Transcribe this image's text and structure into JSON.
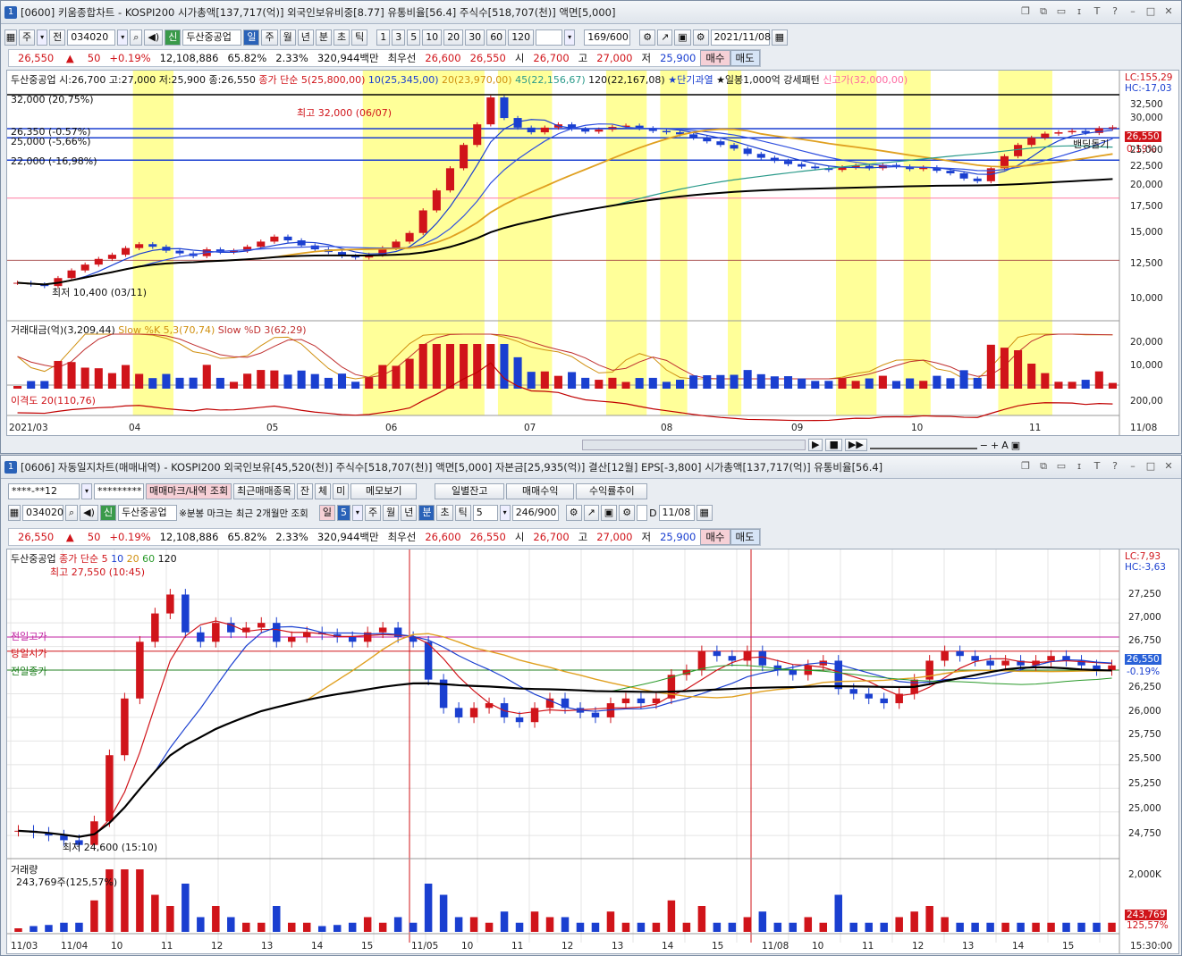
{
  "w1": {
    "title": "[0600] 키움종합차트 - KOSPI200 시가총액[137,717(억)] 외국인보유비중[8.77] 유통비율[56.4] 주식수[518,707(천)] 액면[5,000]",
    "win_num": "1",
    "toolbar": {
      "period_labels": [
        "주",
        "전"
      ],
      "code": "034020",
      "stock_badge": "신",
      "stock_name": "두산중공업",
      "periods": [
        "일",
        "주",
        "월",
        "년",
        "분",
        "초",
        "틱"
      ],
      "ticks": [
        "1",
        "3",
        "5",
        "10",
        "20",
        "30",
        "60",
        "120"
      ],
      "count": "169/600",
      "date": "2021/11/08"
    },
    "quote": {
      "price": "26,550",
      "arrow": "▲",
      "chg": "50",
      "pct": "+0.19%",
      "vol": "12,108,886",
      "p1": "65.82%",
      "p2": "2.33%",
      "amt": "320,944백만",
      "best": "최우선",
      "bid": "26,600",
      "ask": "26,550",
      "open_l": "시",
      "open": "26,700",
      "high_l": "고",
      "high": "27,000",
      "low_l": "저",
      "low": "25,900",
      "buy": "매수",
      "sell": "매도"
    },
    "legend": {
      "stock": "두산중공업 시:26,700 고:27,000 저:25,900 종:26,550",
      "ma_title": "종가 단순",
      "ma5": "5(25,800,00)",
      "ma10": "10(25,345,00)",
      "ma20": "20(23,970,00)",
      "ma45": "45(22,156,67)",
      "ma120": "120(22,167,08)",
      "star1": "★단기과열",
      "star2": "★일봉1,000억 강세패턴",
      "newhigh": "신고가(32,000,00)"
    },
    "right_tags": {
      "lc": "LC:155,29",
      "hc": "HC:-17,03",
      "price": "26,550",
      "pct": "0.19%"
    },
    "yaxis": [
      "32,500",
      "30,000",
      "27,500",
      "25,000",
      "22,500",
      "20,000",
      "17,500",
      "15,000",
      "12,500",
      "10,000"
    ],
    "hlines": {
      "l1": "32,000 (20,75%)",
      "l2": "26,350 (-0.57%)",
      "l3": "25,000 (-5,66%)",
      "l4": "22,000 (-16,98%)",
      "high": "최고 32,000 (06/07)",
      "low": "최저 10,400 (03/11)",
      "note": "밴딩돌기"
    },
    "sub": {
      "legend1": "거래대금(억)(3,209,44)",
      "legend2": "Slow %K 5,3(70,74)",
      "legend3": "Slow %D 3(62,29)",
      "y1": "20,000",
      "y2": "10,000"
    },
    "disp": {
      "legend": "이격도 20(110,76)",
      "y": "200,00"
    },
    "xaxis": [
      "2021/03",
      "04",
      "05",
      "06",
      "07",
      "08",
      "09",
      "10",
      "11",
      "11/08"
    ],
    "colors": {
      "ma5": "#1a3fd0",
      "ma20": "#e0a020",
      "ma45": "#2a9a8a",
      "ma120": "#000000",
      "up": "#d0141a",
      "dn": "#1a3fd0",
      "band": "#ffff99"
    },
    "chart_data": {
      "type": "candlestick",
      "title": "두산중공업",
      "ylim": [
        9000,
        33500
      ],
      "note": "daily candles 2021/03-2021/11/08",
      "closes": [
        10900,
        10800,
        10700,
        11200,
        11700,
        12100,
        12500,
        12800,
        13300,
        13600,
        13400,
        13100,
        12900,
        12700,
        13200,
        13000,
        13100,
        13400,
        13800,
        14200,
        13900,
        13500,
        13200,
        13000,
        12700,
        12600,
        12800,
        13300,
        13800,
        14500,
        16500,
        18500,
        21000,
        24000,
        27000,
        31500,
        28000,
        26500,
        25800,
        26500,
        27000,
        26300,
        25900,
        26200,
        26600,
        26800,
        26400,
        26000,
        25800,
        25500,
        25000,
        24500,
        24000,
        23500,
        22800,
        22300,
        21900,
        21500,
        21200,
        21000,
        20800,
        21100,
        21300,
        21000,
        21400,
        21200,
        20900,
        21100,
        20700,
        20400,
        19800,
        19500,
        21000,
        22500,
        24000,
        25000,
        25600,
        25800,
        26000,
        25700,
        26400,
        26550
      ]
    }
  },
  "w2": {
    "title": "[0606] 자동일지차트(매매내역) - KOSPI200 외국인보유[45,520(천)] 주식수[518,707(천)] 액면[5,000] 자본금[25,935(억)] 결산[12월] EPS[-3,800] 시가총액[137,717(억)] 유통비율[56.4]",
    "win_num": "1",
    "toolbar1": {
      "acct": "****-**12",
      "pw": "*********",
      "b1": "매매마크/내역 조회",
      "b2": "최근매매종목",
      "b3": "잔",
      "b4": "체",
      "b5": "미",
      "b6": "메모보기",
      "b7": "일별잔고",
      "b8": "매매수익",
      "b9": "수익률추이"
    },
    "toolbar2": {
      "code": "034020",
      "stock_badge": "신",
      "stock_name": "두산중공업",
      "note": "※분봉 마크는 최근 2개월만 조회",
      "day": "일",
      "min_val": "5",
      "periods": [
        "주",
        "월",
        "년",
        "분",
        "초",
        "틱"
      ],
      "tick_val": "5",
      "count": "246/900",
      "d_label": "D",
      "date": "11/08"
    },
    "quote": {
      "price": "26,550",
      "arrow": "▲",
      "chg": "50",
      "pct": "+0.19%",
      "vol": "12,108,886",
      "p1": "65.82%",
      "p2": "2.33%",
      "amt": "320,944백만",
      "best": "최우선",
      "bid": "26,600",
      "ask": "26,550",
      "open_l": "시",
      "open": "26,700",
      "high_l": "고",
      "high": "27,000",
      "low_l": "저",
      "low": "25,900",
      "buy": "매수",
      "sell": "매도"
    },
    "legend": {
      "stock": "두산중공업",
      "ma_title": "종가 단순",
      "m5": "5",
      "m10": "10",
      "m20": "20",
      "m60": "60",
      "m120": "120",
      "high": "최고 27,550 (10:45)",
      "low": "최저 24,600 (15:10)",
      "prev_high": "전일고가",
      "today_open": "당일시가",
      "prev_close": "전일종가"
    },
    "right_tags": {
      "lc": "LC:7,93",
      "hc": "HC:-3,63",
      "price": "26,550",
      "pct": "-0.19%"
    },
    "yaxis": [
      "27,250",
      "27,000",
      "26,750",
      "26,500",
      "26,250",
      "26,000",
      "25,750",
      "25,500",
      "25,250",
      "25,000",
      "24,750"
    ],
    "vol": {
      "legend": "거래량",
      "value": "243,769주(125,57%)",
      "y": "2,000K",
      "tag1": "243,769",
      "tag2": "125,57%"
    },
    "xaxis": [
      "11/03",
      "11/04",
      "10",
      "11",
      "12",
      "13",
      "14",
      "15",
      "11/05",
      "10",
      "11",
      "12",
      "13",
      "14",
      "15",
      "11/08",
      "10",
      "11",
      "12",
      "13",
      "14",
      "15",
      "15:30:00"
    ],
    "chart_data": {
      "type": "candlestick",
      "title": "두산중공업 5분",
      "ylim": [
        24600,
        27550
      ],
      "closes": [
        24800,
        24780,
        24750,
        24700,
        24650,
        24900,
        25600,
        26200,
        26800,
        27100,
        27300,
        26900,
        26800,
        27000,
        26900,
        26950,
        27000,
        26800,
        26850,
        26900,
        26880,
        26850,
        26800,
        26900,
        26950,
        26850,
        26800,
        26400,
        26100,
        26000,
        26100,
        26150,
        26000,
        25950,
        26100,
        26200,
        26100,
        26050,
        26000,
        26150,
        26200,
        26150,
        26200,
        26450,
        26500,
        26700,
        26650,
        26600,
        26700,
        26550,
        26500,
        26450,
        26550,
        26600,
        26300,
        26250,
        26200,
        26150,
        26250,
        26400,
        26600,
        26700,
        26650,
        26600,
        26550,
        26600,
        26550,
        26600,
        26650,
        26600,
        26550,
        26500,
        26550
      ]
    }
  }
}
